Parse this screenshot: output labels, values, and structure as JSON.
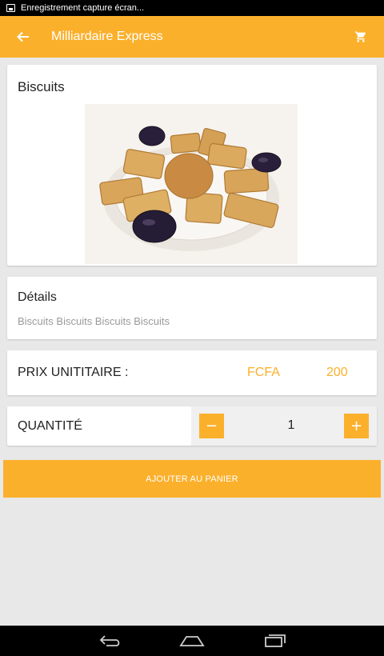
{
  "status_bar": {
    "notification_text": "Enregistrement capture écran..."
  },
  "app_bar": {
    "title": "Milliardaire Express",
    "back_icon": "arrow-back-icon",
    "cart_icon": "cart-icon"
  },
  "product": {
    "name": "Biscuits"
  },
  "details": {
    "title": "Détails",
    "description": "Biscuits Biscuits Biscuits Biscuits"
  },
  "price": {
    "label": "PRIX UNITITAIRE :",
    "currency": "FCFA",
    "value": "200"
  },
  "quantity": {
    "label": "QUANTITÉ",
    "value": "1",
    "minus": "−",
    "plus": "+"
  },
  "actions": {
    "add_to_cart": "AJOUTER AU PANIER"
  },
  "colors": {
    "accent": "#fbb02c",
    "background": "#e8e8e8"
  }
}
